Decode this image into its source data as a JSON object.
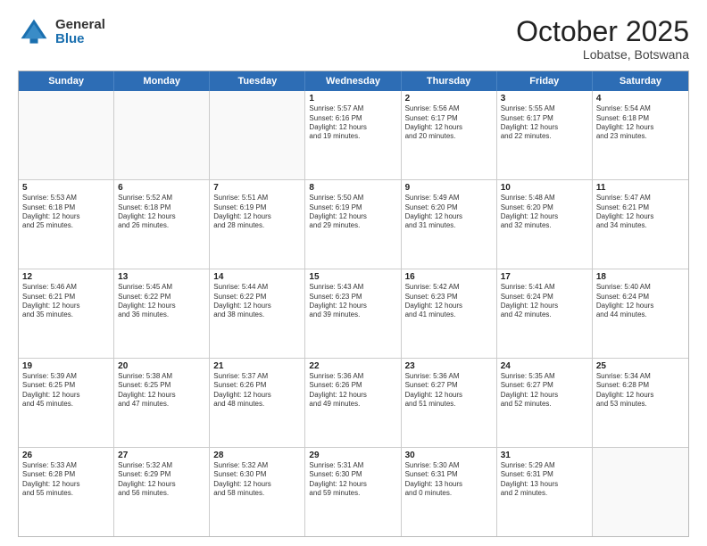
{
  "logo": {
    "general": "General",
    "blue": "Blue"
  },
  "title": "October 2025",
  "location": "Lobatse, Botswana",
  "days_of_week": [
    "Sunday",
    "Monday",
    "Tuesday",
    "Wednesday",
    "Thursday",
    "Friday",
    "Saturday"
  ],
  "weeks": [
    [
      {
        "day": "",
        "text": "",
        "empty": true
      },
      {
        "day": "",
        "text": "",
        "empty": true
      },
      {
        "day": "",
        "text": "",
        "empty": true
      },
      {
        "day": "1",
        "text": "Sunrise: 5:57 AM\nSunset: 6:16 PM\nDaylight: 12 hours\nand 19 minutes.",
        "empty": false
      },
      {
        "day": "2",
        "text": "Sunrise: 5:56 AM\nSunset: 6:17 PM\nDaylight: 12 hours\nand 20 minutes.",
        "empty": false
      },
      {
        "day": "3",
        "text": "Sunrise: 5:55 AM\nSunset: 6:17 PM\nDaylight: 12 hours\nand 22 minutes.",
        "empty": false
      },
      {
        "day": "4",
        "text": "Sunrise: 5:54 AM\nSunset: 6:18 PM\nDaylight: 12 hours\nand 23 minutes.",
        "empty": false
      }
    ],
    [
      {
        "day": "5",
        "text": "Sunrise: 5:53 AM\nSunset: 6:18 PM\nDaylight: 12 hours\nand 25 minutes.",
        "empty": false
      },
      {
        "day": "6",
        "text": "Sunrise: 5:52 AM\nSunset: 6:18 PM\nDaylight: 12 hours\nand 26 minutes.",
        "empty": false
      },
      {
        "day": "7",
        "text": "Sunrise: 5:51 AM\nSunset: 6:19 PM\nDaylight: 12 hours\nand 28 minutes.",
        "empty": false
      },
      {
        "day": "8",
        "text": "Sunrise: 5:50 AM\nSunset: 6:19 PM\nDaylight: 12 hours\nand 29 minutes.",
        "empty": false
      },
      {
        "day": "9",
        "text": "Sunrise: 5:49 AM\nSunset: 6:20 PM\nDaylight: 12 hours\nand 31 minutes.",
        "empty": false
      },
      {
        "day": "10",
        "text": "Sunrise: 5:48 AM\nSunset: 6:20 PM\nDaylight: 12 hours\nand 32 minutes.",
        "empty": false
      },
      {
        "day": "11",
        "text": "Sunrise: 5:47 AM\nSunset: 6:21 PM\nDaylight: 12 hours\nand 34 minutes.",
        "empty": false
      }
    ],
    [
      {
        "day": "12",
        "text": "Sunrise: 5:46 AM\nSunset: 6:21 PM\nDaylight: 12 hours\nand 35 minutes.",
        "empty": false
      },
      {
        "day": "13",
        "text": "Sunrise: 5:45 AM\nSunset: 6:22 PM\nDaylight: 12 hours\nand 36 minutes.",
        "empty": false
      },
      {
        "day": "14",
        "text": "Sunrise: 5:44 AM\nSunset: 6:22 PM\nDaylight: 12 hours\nand 38 minutes.",
        "empty": false
      },
      {
        "day": "15",
        "text": "Sunrise: 5:43 AM\nSunset: 6:23 PM\nDaylight: 12 hours\nand 39 minutes.",
        "empty": false
      },
      {
        "day": "16",
        "text": "Sunrise: 5:42 AM\nSunset: 6:23 PM\nDaylight: 12 hours\nand 41 minutes.",
        "empty": false
      },
      {
        "day": "17",
        "text": "Sunrise: 5:41 AM\nSunset: 6:24 PM\nDaylight: 12 hours\nand 42 minutes.",
        "empty": false
      },
      {
        "day": "18",
        "text": "Sunrise: 5:40 AM\nSunset: 6:24 PM\nDaylight: 12 hours\nand 44 minutes.",
        "empty": false
      }
    ],
    [
      {
        "day": "19",
        "text": "Sunrise: 5:39 AM\nSunset: 6:25 PM\nDaylight: 12 hours\nand 45 minutes.",
        "empty": false
      },
      {
        "day": "20",
        "text": "Sunrise: 5:38 AM\nSunset: 6:25 PM\nDaylight: 12 hours\nand 47 minutes.",
        "empty": false
      },
      {
        "day": "21",
        "text": "Sunrise: 5:37 AM\nSunset: 6:26 PM\nDaylight: 12 hours\nand 48 minutes.",
        "empty": false
      },
      {
        "day": "22",
        "text": "Sunrise: 5:36 AM\nSunset: 6:26 PM\nDaylight: 12 hours\nand 49 minutes.",
        "empty": false
      },
      {
        "day": "23",
        "text": "Sunrise: 5:36 AM\nSunset: 6:27 PM\nDaylight: 12 hours\nand 51 minutes.",
        "empty": false
      },
      {
        "day": "24",
        "text": "Sunrise: 5:35 AM\nSunset: 6:27 PM\nDaylight: 12 hours\nand 52 minutes.",
        "empty": false
      },
      {
        "day": "25",
        "text": "Sunrise: 5:34 AM\nSunset: 6:28 PM\nDaylight: 12 hours\nand 53 minutes.",
        "empty": false
      }
    ],
    [
      {
        "day": "26",
        "text": "Sunrise: 5:33 AM\nSunset: 6:28 PM\nDaylight: 12 hours\nand 55 minutes.",
        "empty": false
      },
      {
        "day": "27",
        "text": "Sunrise: 5:32 AM\nSunset: 6:29 PM\nDaylight: 12 hours\nand 56 minutes.",
        "empty": false
      },
      {
        "day": "28",
        "text": "Sunrise: 5:32 AM\nSunset: 6:30 PM\nDaylight: 12 hours\nand 58 minutes.",
        "empty": false
      },
      {
        "day": "29",
        "text": "Sunrise: 5:31 AM\nSunset: 6:30 PM\nDaylight: 12 hours\nand 59 minutes.",
        "empty": false
      },
      {
        "day": "30",
        "text": "Sunrise: 5:30 AM\nSunset: 6:31 PM\nDaylight: 13 hours\nand 0 minutes.",
        "empty": false
      },
      {
        "day": "31",
        "text": "Sunrise: 5:29 AM\nSunset: 6:31 PM\nDaylight: 13 hours\nand 2 minutes.",
        "empty": false
      },
      {
        "day": "",
        "text": "",
        "empty": true
      }
    ]
  ]
}
